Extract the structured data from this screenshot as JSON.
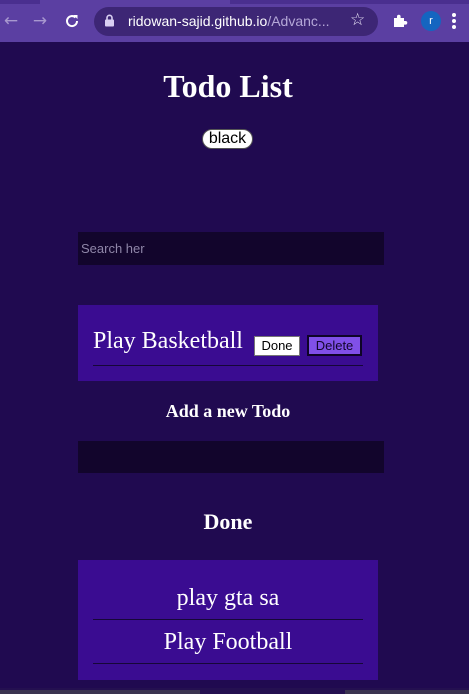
{
  "browser": {
    "url_host": "ridowan-sajid.github.io",
    "url_path": "/Advanc...",
    "profile_initial": "r",
    "icons": {
      "back": "arrow-left",
      "forward": "arrow-right",
      "reload": "reload",
      "lock": "lock",
      "star": "star",
      "extensions": "puzzle-piece",
      "menu": "three-dots-vertical"
    }
  },
  "page": {
    "title": "Todo List",
    "theme_button": "black",
    "search_placeholder": "Search her",
    "todos": [
      {
        "text": "Play Basketball",
        "done_label": "Done",
        "delete_label": "Delete"
      }
    ],
    "add_heading": "Add a new Todo",
    "add_value": "",
    "done_heading": "Done",
    "done_items": [
      {
        "text": "play gta sa"
      },
      {
        "text": "Play Football"
      }
    ]
  },
  "colors": {
    "background": "#200a50",
    "card": "#3a0c91",
    "input": "#12052c",
    "chrome": "#5b3fa2",
    "delete_button": "#8050e8"
  }
}
